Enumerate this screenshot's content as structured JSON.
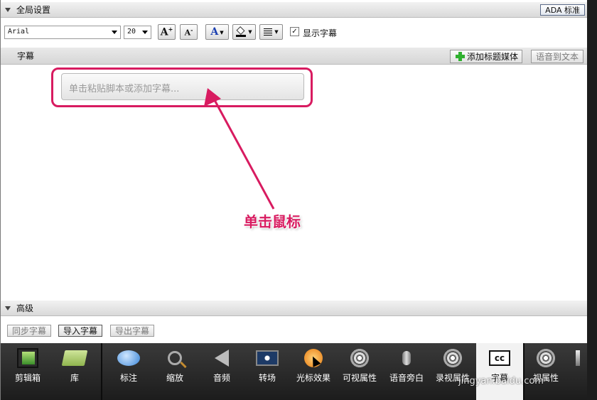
{
  "global_settings": {
    "title": "全局设置",
    "ada_button": "ADA 标准"
  },
  "toolbar": {
    "font": "Arial",
    "size": "20",
    "show_captions": "显示字幕",
    "checked": true
  },
  "captions": {
    "title": "字幕",
    "add_title_media": "添加标题媒体",
    "speech_to_text": "语音到文本",
    "input_placeholder": "单击粘贴脚本或添加字幕..."
  },
  "annotation": {
    "text": "单击鼠标",
    "color": "#d81b60"
  },
  "advanced": {
    "title": "高级",
    "sync": "同步字幕",
    "import": "导入字幕",
    "export": "导出字幕"
  },
  "nav": {
    "items": [
      {
        "label": "剪辑箱",
        "icon": "film-strip-icon"
      },
      {
        "label": "库",
        "icon": "folder-icon"
      },
      {
        "label": "标注",
        "icon": "speech-bubble-icon"
      },
      {
        "label": "缩放",
        "icon": "magnifier-icon"
      },
      {
        "label": "音频",
        "icon": "speaker-icon"
      },
      {
        "label": "转场",
        "icon": "transition-icon"
      },
      {
        "label": "光标效果",
        "icon": "cursor-icon"
      },
      {
        "label": "可视属性",
        "icon": "reel-icon"
      },
      {
        "label": "语音旁白",
        "icon": "microphone-icon"
      },
      {
        "label": "录视属性",
        "icon": "reel-icon"
      },
      {
        "label": "字幕",
        "icon": "cc-icon"
      },
      {
        "label": "视属性",
        "icon": "reel-icon"
      }
    ]
  },
  "watermark": "jingyan.baidu.com"
}
